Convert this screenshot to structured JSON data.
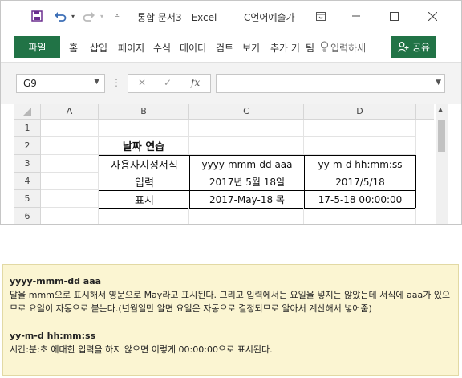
{
  "titlebar": {
    "title": "통합 문서3  -  Excel",
    "user": "C언어예술가",
    "icons": [
      "save-icon",
      "undo-icon",
      "redo-icon",
      "customize-icon",
      "ribbon-display-icon",
      "minimize-icon",
      "maximize-icon",
      "close-icon"
    ]
  },
  "ribbon": {
    "file": "파일",
    "tabs": [
      "홈",
      "삽입",
      "페이지",
      "수식",
      "데이터",
      "검토",
      "보기",
      "추가 기",
      "팀"
    ],
    "tell_me": "입력하세",
    "share": "공유"
  },
  "formula_bar": {
    "name_box": "G9",
    "fx": "fx",
    "formula": ""
  },
  "sheet": {
    "columns": [
      "A",
      "B",
      "C",
      "D"
    ],
    "rows": [
      "1",
      "2",
      "3",
      "4",
      "5",
      "6"
    ],
    "cells": {
      "B2": "날짜 연습",
      "B3": "사용자지정서식",
      "C3": "yyyy-mmm-dd aaa",
      "D3": "yy-m-d hh:mm:ss",
      "B4": "입력",
      "C4": "2017년 5월 18일",
      "D4": "2017/5/18",
      "B5": "표시",
      "C5": "2017-May-18 목",
      "D5": "17-5-18 00:00:00"
    }
  },
  "note": {
    "h1": "yyyy-mmm-dd aaa",
    "p1": "달을 mmm으로 표시해서 영문으로 May라고 표시된다. 그리고 입력에서는 요일을 넣지는 않았는데 서식에 aaa가 있으므로 요일이 자동으로 붙는다.(년월일만 알면 요일은 자동으로 결정되므로 알아서 계산해서 넣어줌)",
    "h2": "yy-m-d hh:mm:ss",
    "p2": "시간:분:초 에대한 입력을 하지 않으면 이렇게 00:00:00으로 표시된다."
  },
  "colors": {
    "accent": "#217346",
    "note_bg": "#fbf5d2"
  }
}
